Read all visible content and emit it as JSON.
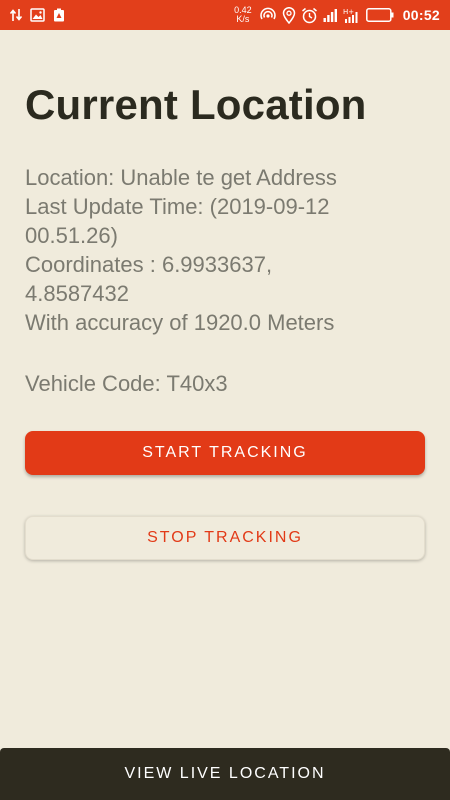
{
  "status_bar": {
    "network_speed_value": "0.42",
    "network_speed_unit": "K/s",
    "time": "00:52",
    "left_icons": [
      "data-transfer-icon",
      "gallery-icon",
      "battery-saver-icon"
    ],
    "right_icons": [
      "hotspot-icon",
      "location-pin-icon",
      "alarm-icon",
      "signal-icon",
      "signal-h-plus-icon",
      "battery-icon"
    ]
  },
  "page": {
    "title": "Current Location"
  },
  "info": {
    "location_line": "Location: Unable te get Address",
    "last_update_line1": "Last Update Time: (2019-09-12",
    "last_update_line2": "00.51.26)",
    "coordinates_line1": "Coordinates : 6.9933637,",
    "coordinates_line2": "4.8587432",
    "accuracy_line": "With accuracy of 1920.0 Meters",
    "vehicle_code_line": "Vehicle Code: T40x3"
  },
  "buttons": {
    "start_tracking": "START TRACKING",
    "stop_tracking": "STOP TRACKING",
    "view_live_location": "VIEW LIVE LOCATION"
  },
  "colors": {
    "accent": "#e23a17",
    "status_bar": "#e23f1b",
    "background": "#f0ebdc",
    "title_text": "#2b2a1f",
    "body_text": "#7b7a70",
    "bottom_bar": "#2e2b1f"
  }
}
